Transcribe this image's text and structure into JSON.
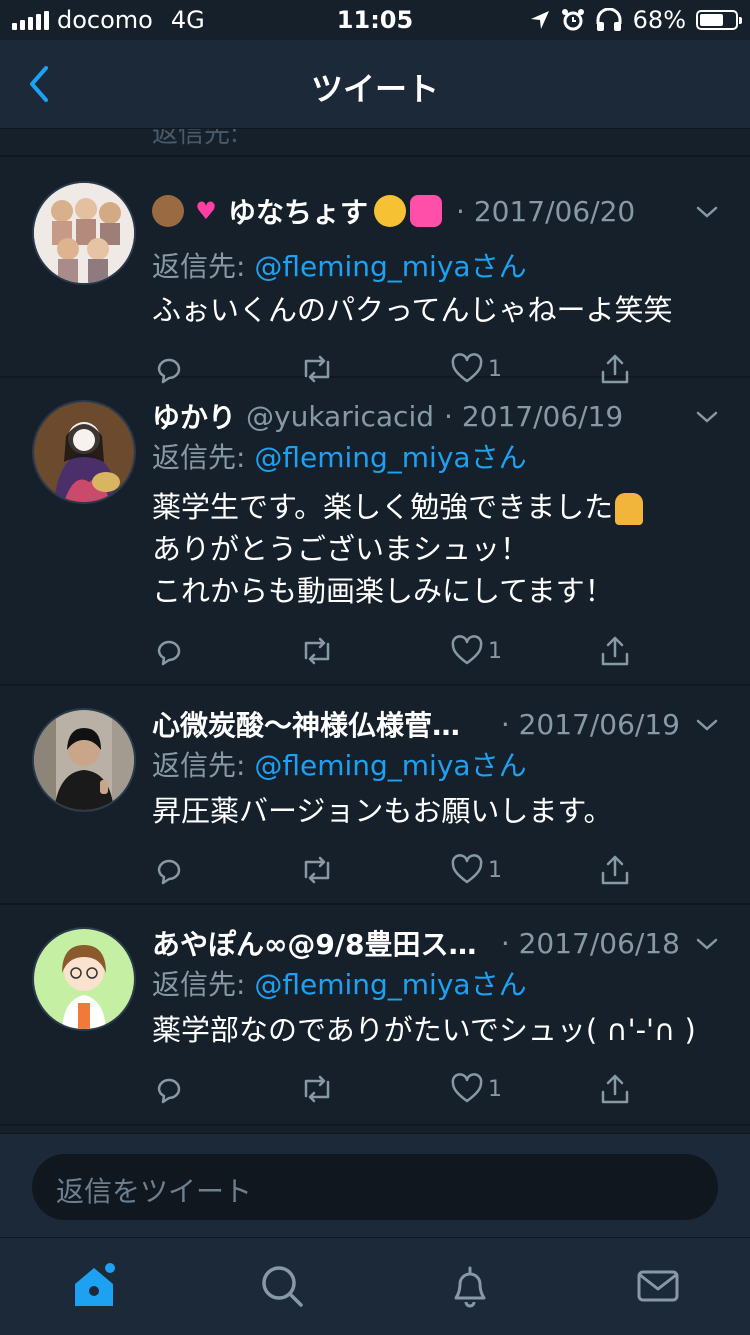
{
  "status_bar": {
    "carrier": "docomo",
    "network": "4G",
    "time": "11:05",
    "battery_percent": "68%",
    "battery_level": 0.68
  },
  "nav": {
    "title": "ツイート"
  },
  "peek_text": "返信先:",
  "reply_prefix": "返信先:",
  "tweets": [
    {
      "name": "ゆなちょす",
      "handle": "",
      "date": "· 2017/06/20",
      "reply_to": "@fleming_miyaさん",
      "lines": [
        "ふぉいくんのパクってんじゃねーよ笑笑"
      ],
      "likes": "1"
    },
    {
      "name": "ゆかり",
      "handle": "@yukaricacid",
      "date": "· 2017/06/19",
      "reply_to": "@fleming_miyaさん",
      "lines": [
        "薬学生です。楽しく勉強できました",
        "ありがとうございまシュッ！",
        "これからも動画楽しみにしてます！"
      ],
      "likes": "1"
    },
    {
      "name": "心微炭酸〜神様仏様菅田…",
      "handle": "",
      "date": "· 2017/06/19",
      "reply_to": "@fleming_miyaさん",
      "lines": [
        "昇圧薬バージョンもお願いします。"
      ],
      "likes": "1"
    },
    {
      "name": "あやぽん∞@9/8豊田スタ…",
      "handle": "",
      "date": "· 2017/06/18",
      "reply_to": "@fleming_miyaさん",
      "lines": [
        "薬学部なのでありがたいでシュッ( ∩'-'∩ )"
      ],
      "likes": "1"
    }
  ],
  "composer": {
    "placeholder": "返信をツイート"
  },
  "tabbar": {
    "items": [
      "home-icon",
      "search-icon",
      "notifications-icon",
      "messages-icon"
    ]
  },
  "colors": {
    "background": "#15202b",
    "bar": "#1c2938",
    "accent": "#1da1f2",
    "muted": "#8899a6"
  }
}
